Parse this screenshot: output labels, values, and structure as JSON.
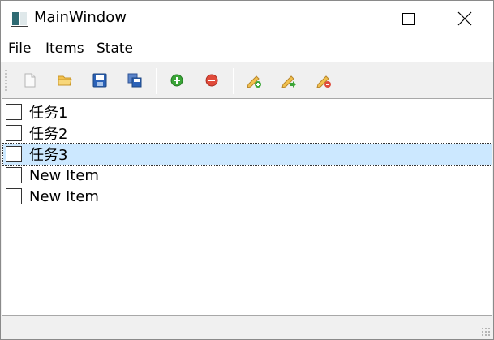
{
  "window": {
    "title": "MainWindow"
  },
  "menubar": {
    "items": [
      "File",
      "Items",
      "State"
    ]
  },
  "toolbar": {
    "buttons": [
      {
        "icon": "new-file-icon"
      },
      {
        "icon": "open-folder-icon"
      },
      {
        "icon": "save-icon"
      },
      {
        "icon": "save-all-icon"
      },
      {
        "icon": "add-item-icon"
      },
      {
        "icon": "remove-item-icon"
      },
      {
        "icon": "edit-add-icon"
      },
      {
        "icon": "edit-forward-icon"
      },
      {
        "icon": "edit-remove-icon"
      }
    ]
  },
  "list": {
    "items": [
      {
        "label": "任务1",
        "checked": false,
        "selected": false
      },
      {
        "label": "任务2",
        "checked": false,
        "selected": false
      },
      {
        "label": "任务3",
        "checked": false,
        "selected": true
      },
      {
        "label": "New Item",
        "checked": false,
        "selected": false
      },
      {
        "label": "New Item",
        "checked": false,
        "selected": false
      }
    ]
  },
  "colors": {
    "selection": "#cce8ff",
    "save_blue": "#2b62b8",
    "add_green": "#3aa537",
    "remove_red": "#e04a3a",
    "folder_yellow": "#f2c14e"
  }
}
